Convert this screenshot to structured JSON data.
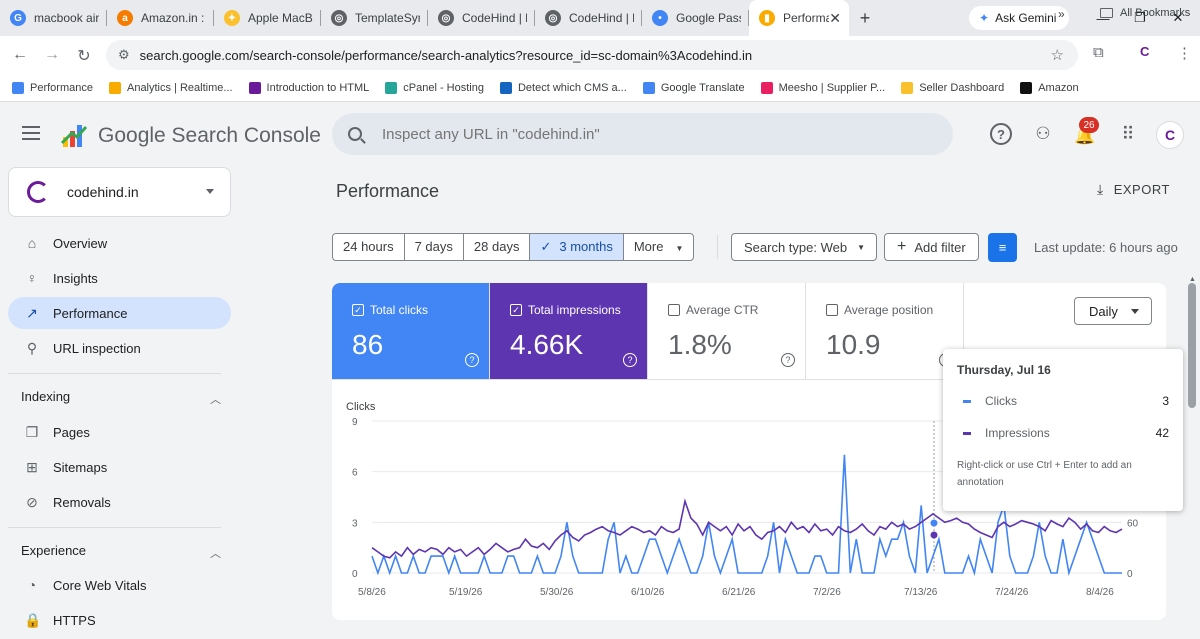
{
  "browser": {
    "tabs": [
      {
        "label": "macbook air n",
        "icon_color": "#4285f4",
        "icon_char": "G"
      },
      {
        "label": "Amazon.in : ra",
        "icon_color": "#f57c00",
        "icon_char": "a"
      },
      {
        "label": "Apple MacBo",
        "icon_color": "#fbc02d",
        "icon_char": "✦"
      },
      {
        "label": "TemplateSynta",
        "icon_color": "#5f6368",
        "icon_char": "◎"
      },
      {
        "label": "CodeHind | Be",
        "icon_color": "#5f6368",
        "icon_char": "◎"
      },
      {
        "label": "CodeHind | Be",
        "icon_color": "#5f6368",
        "icon_char": "◎"
      },
      {
        "label": "Google Passw",
        "icon_color": "#4285f4",
        "icon_char": "•"
      },
      {
        "label": "Performar",
        "icon_color": "#f9ab00",
        "icon_char": "▮",
        "active": true
      }
    ],
    "new_tab": "+",
    "ask_gemini": "Ask Gemini",
    "url": "search.google.com/search-console/performance/search-analytics?resource_id=sc-domain%3Acodehind.in",
    "bookmarks": [
      {
        "label": "Performance",
        "color": "#4285f4"
      },
      {
        "label": "Analytics | Realtime...",
        "color": "#f9ab00"
      },
      {
        "label": "Introduction to HTML",
        "color": "#6a1b9a"
      },
      {
        "label": "cPanel - Hosting",
        "color": "#26a69a"
      },
      {
        "label": "Detect which CMS a...",
        "color": "#1565c0"
      },
      {
        "label": "Google Translate",
        "color": "#4285f4"
      },
      {
        "label": "Meesho | Supplier P...",
        "color": "#e91e63"
      },
      {
        "label": "Seller Dashboard",
        "color": "#fbc02d"
      },
      {
        "label": "Amazon",
        "color": "#111111"
      }
    ],
    "bookmarks_more": "»",
    "all_bookmarks": "All Bookmarks"
  },
  "app": {
    "title": "Google Search Console",
    "search_placeholder": "Inspect any URL in \"codehind.in\"",
    "notification_count": "26",
    "avatar_letter": "C"
  },
  "sidebar": {
    "property": "codehind.in",
    "items": [
      {
        "label": "Overview",
        "icon": "home-icon",
        "glyph": "⌂"
      },
      {
        "label": "Insights",
        "icon": "lightbulb-icon",
        "glyph": "♀"
      },
      {
        "label": "Performance",
        "icon": "trending-up-icon",
        "glyph": "↗",
        "active": true
      },
      {
        "label": "URL inspection",
        "icon": "search-icon",
        "glyph": "⚲"
      }
    ],
    "indexing_header": "Indexing",
    "indexing_items": [
      {
        "label": "Pages",
        "icon": "pages-icon",
        "glyph": "❐"
      },
      {
        "label": "Sitemaps",
        "icon": "sitemap-icon",
        "glyph": "⊞"
      },
      {
        "label": "Removals",
        "icon": "visibility-off-icon",
        "glyph": "⊘"
      }
    ],
    "experience_header": "Experience",
    "experience_items": [
      {
        "label": "Core Web Vitals",
        "icon": "speed-icon",
        "glyph": "◔"
      },
      {
        "label": "HTTPS",
        "icon": "lock-icon",
        "glyph": "🔒"
      }
    ]
  },
  "main": {
    "title": "Performance",
    "export_label": "EXPORT",
    "ranges": [
      "24 hours",
      "7 days",
      "28 days",
      "3 months",
      "More"
    ],
    "selected_range": "3 months",
    "search_type": "Search type: Web",
    "add_filter": "Add filter",
    "last_update": "Last update: 6 hours ago",
    "metrics": [
      {
        "label": "Total clicks",
        "value": "86",
        "checked": true
      },
      {
        "label": "Total impressions",
        "value": "4.66K",
        "checked": true
      },
      {
        "label": "Average CTR",
        "value": "1.8%",
        "checked": false
      },
      {
        "label": "Average position",
        "value": "10.9",
        "checked": false
      }
    ],
    "granularity": "Daily"
  },
  "tooltip": {
    "date": "Thursday, Jul 16",
    "rows": [
      {
        "label": "Clicks",
        "value": "3",
        "color": "#4285f4"
      },
      {
        "label": "Impressions",
        "value": "42",
        "color": "#5e35b1"
      }
    ],
    "note": "Right-click or use Ctrl + Enter to add an annotation"
  },
  "chart_data": {
    "type": "line",
    "left_axis_label": "Clicks",
    "left_ticks": [
      "9",
      "6",
      "3",
      "0"
    ],
    "left_ylim": [
      0,
      9
    ],
    "right_ticks": [
      "60",
      "0"
    ],
    "right_ylim": [
      0,
      180
    ],
    "x_ticks": [
      "5/8/26",
      "5/19/26",
      "5/30/26",
      "6/10/26",
      "6/21/26",
      "7/2/26",
      "7/13/26",
      "7/24/26",
      "8/4/26"
    ],
    "series": [
      {
        "name": "Clicks",
        "color": "#4285f4",
        "axis": "left",
        "values": [
          1,
          0,
          1,
          0,
          1,
          0,
          0,
          1,
          0,
          0,
          1,
          1,
          1,
          0,
          1,
          0,
          0,
          0,
          0,
          1,
          0,
          0,
          0,
          1,
          1,
          0,
          0,
          0,
          1,
          0,
          0,
          0,
          1,
          3,
          1,
          0,
          0,
          0,
          0,
          0,
          2,
          3,
          0,
          1,
          0,
          0,
          1,
          2,
          2,
          1,
          0,
          1,
          2,
          1,
          0,
          0,
          1,
          3,
          1,
          0,
          1,
          2,
          0,
          0,
          0,
          0,
          0,
          1,
          3,
          0,
          2,
          1,
          0,
          0,
          0,
          1,
          1,
          0,
          0,
          0,
          7,
          0,
          2,
          0,
          0,
          0,
          2,
          1,
          2,
          2,
          3,
          1,
          0,
          4,
          0,
          1,
          2,
          0,
          0,
          0,
          0,
          1,
          0,
          2,
          1,
          0,
          3,
          4,
          1,
          0,
          0,
          0,
          1,
          3,
          1,
          0,
          0,
          2,
          0,
          1,
          2,
          3,
          2,
          1,
          0,
          0,
          0,
          0
        ]
      },
      {
        "name": "Impressions",
        "color": "#5e35b1",
        "axis": "right",
        "values": [
          30,
          25,
          20,
          18,
          25,
          20,
          30,
          22,
          28,
          25,
          30,
          28,
          22,
          30,
          25,
          28,
          20,
          25,
          30,
          22,
          28,
          35,
          30,
          25,
          28,
          30,
          40,
          32,
          30,
          35,
          28,
          38,
          45,
          50,
          42,
          38,
          45,
          48,
          52,
          55,
          50,
          48,
          45,
          50,
          55,
          52,
          48,
          50,
          45,
          55,
          50,
          48,
          52,
          85,
          65,
          58,
          45,
          60,
          55,
          50,
          55,
          45,
          58,
          50,
          55,
          45,
          40,
          48,
          50,
          55,
          48,
          60,
          52,
          55,
          48,
          58,
          50,
          52,
          45,
          55,
          50,
          48,
          52,
          58,
          50,
          45,
          55,
          52,
          60,
          55,
          58,
          52,
          55,
          60,
          65,
          70,
          65,
          60,
          62,
          65,
          60,
          58,
          52,
          48,
          45,
          42,
          55,
          60,
          55,
          58,
          62,
          60,
          58,
          55,
          50,
          62,
          58,
          55,
          65,
          60,
          52,
          58,
          50,
          48,
          55,
          50,
          48,
          52
        ]
      }
    ]
  }
}
